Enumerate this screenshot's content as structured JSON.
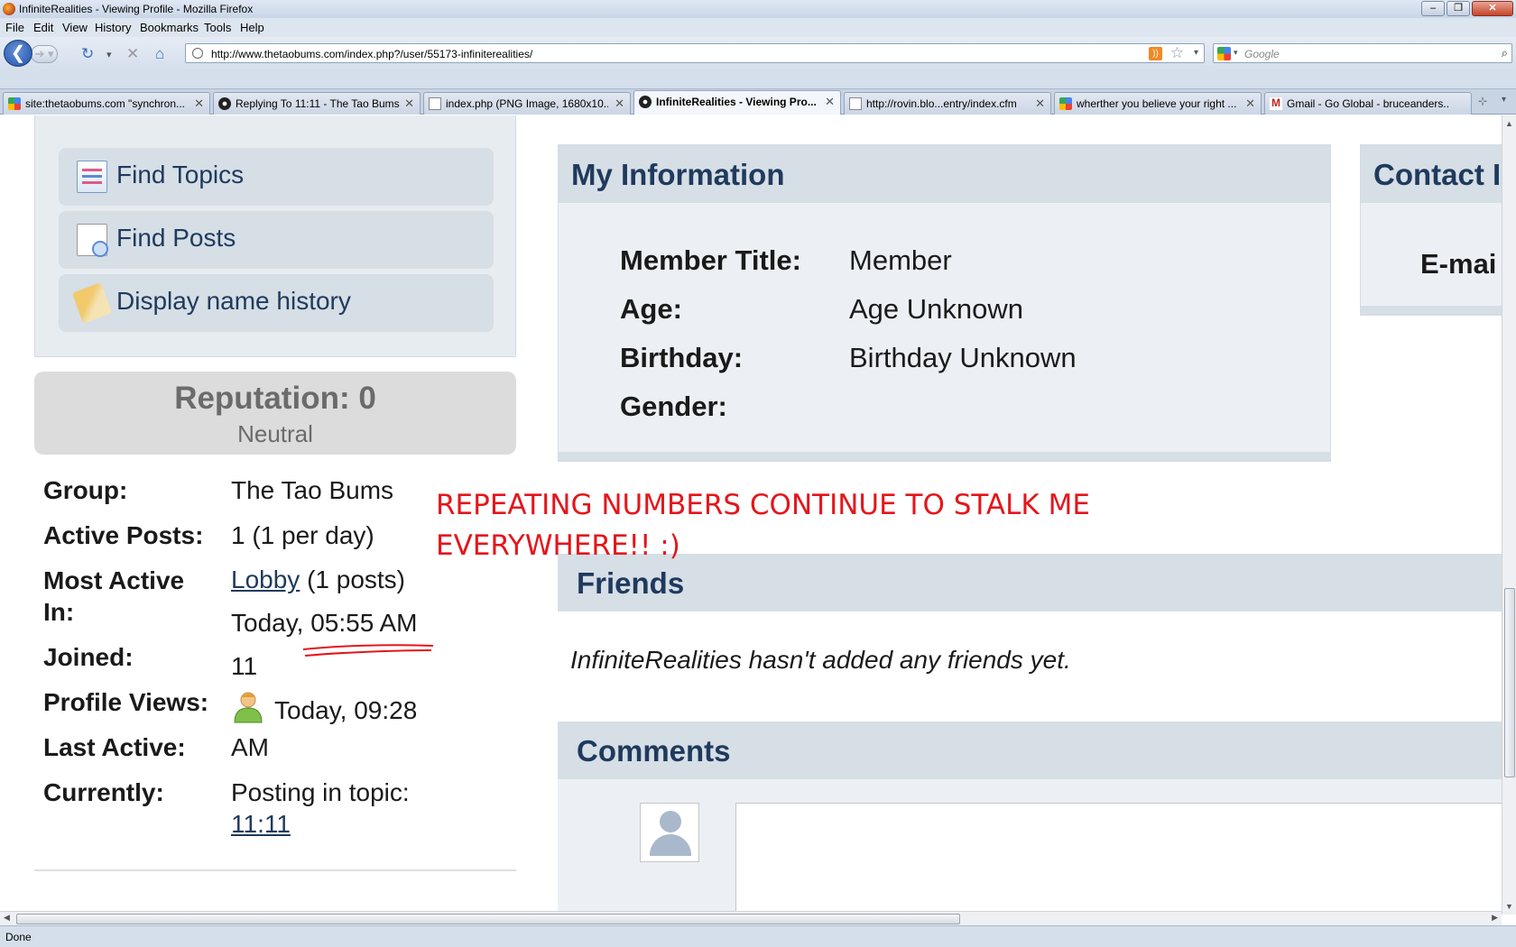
{
  "window": {
    "title": "InfiniteRealities - Viewing Profile - Mozilla Firefox"
  },
  "menu": [
    "File",
    "Edit",
    "View",
    "History",
    "Bookmarks",
    "Tools",
    "Help"
  ],
  "nav": {
    "url": "http://www.thetaobums.com/index.php?/user/55173-infiniterealities/",
    "search_placeholder": "Google"
  },
  "tabs": [
    {
      "label": "site:thetaobums.com \"synchron...",
      "icon": "google-icon",
      "active": false
    },
    {
      "label": "Replying To 11:11 - The Tao Bums",
      "icon": "taobums-icon",
      "active": false
    },
    {
      "label": "index.php (PNG Image, 1680x10...",
      "icon": "document-icon",
      "active": false
    },
    {
      "label": "InfiniteRealities - Viewing Pro...",
      "icon": "taobums-icon",
      "active": true
    },
    {
      "label": "http://rovin.blo...entry/index.cfm",
      "icon": "document-icon",
      "active": false
    },
    {
      "label": "wherther you believe your right ...",
      "icon": "google-icon",
      "active": false
    },
    {
      "label": "Gmail - Go Global - bruceanders...",
      "icon": "gmail-icon",
      "active": false
    }
  ],
  "sidebar": {
    "links": [
      {
        "label": "Find Topics",
        "icon": "find-topics-icon"
      },
      {
        "label": "Find Posts",
        "icon": "find-posts-icon"
      },
      {
        "label": "Display name history",
        "icon": "name-history-icon"
      }
    ]
  },
  "reputation": {
    "title": "Reputation: 0",
    "status": "Neutral"
  },
  "profile_stats": {
    "group_label": "Group:",
    "group_value": "The Tao Bums",
    "posts_label": "Active Posts:",
    "posts_value": "1 (1 per day)",
    "most_active_label_1": "Most Active",
    "most_active_label_2": "In:",
    "most_active_link": "Lobby",
    "most_active_count": "(1 posts)",
    "joined_label": "Joined:",
    "joined_value_1": "Today, 05:55 AM",
    "joined_value_2": "11",
    "views_label": "Profile Views:",
    "last_active_label": "Last Active:",
    "last_active_value_1": "Today, 09:28",
    "last_active_value_2": "AM",
    "currently_label": "Currently:",
    "currently_value": "Posting in topic:",
    "currently_link": "11:11"
  },
  "my_information": {
    "title": "My Information",
    "rows": [
      {
        "label": "Member Title:",
        "value": "Member"
      },
      {
        "label": "Age:",
        "value": "Age Unknown"
      },
      {
        "label": "Birthday:",
        "value": "Birthday Unknown"
      },
      {
        "label": "Gender:",
        "value": ""
      }
    ]
  },
  "contact": {
    "title": "Contact I",
    "email_label": "E-mai"
  },
  "annotation": {
    "line1": "REPEATING NUMBERS CONTINUE TO STALK ME",
    "line2": "EVERYWHERE!! :)",
    "color": "#e4161c"
  },
  "friends": {
    "title": "Friends",
    "empty_text": "InfiniteRealities hasn't added any friends yet."
  },
  "comments": {
    "title": "Comments"
  },
  "status": "Done"
}
